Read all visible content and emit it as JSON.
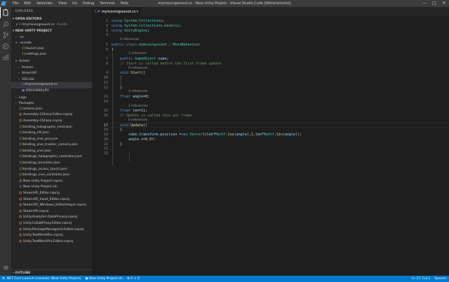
{
  "titlebar": {
    "menu": [
      "File",
      "Edit",
      "Selection",
      "View",
      "Go",
      "Debug",
      "Terminal",
      "Help"
    ],
    "window_title": "mymovingsound.cs - New Unity Project - Visual Studio Code [Administrator]",
    "minimize": "—",
    "maximize": "□",
    "close": "✕"
  },
  "activitybar": {
    "icons": [
      "explorer-icon",
      "search-icon",
      "source-control-icon",
      "debug-icon",
      "extensions-icon"
    ],
    "settings": "gear-icon"
  },
  "sidebar": {
    "header": "EXPLORER",
    "open_editors": "OPEN EDITORS",
    "open_file": {
      "name": "mymovingsound.cs",
      "path": "Assets"
    },
    "project": "NEW UNITY PROJECT",
    "tree": [
      {
        "label": ".vs",
        "indent": 1,
        "kind": "folder-closed"
      },
      {
        "label": ".vscode",
        "indent": 1,
        "kind": "folder-open"
      },
      {
        "label": "launch.json",
        "indent": 2,
        "kind": "json"
      },
      {
        "label": "settings.json",
        "indent": 2,
        "kind": "json"
      },
      {
        "label": "Assets",
        "indent": 1,
        "kind": "folder-open"
      },
      {
        "label": "Scenes",
        "indent": 2,
        "kind": "folder-closed"
      },
      {
        "label": "SteamVR",
        "indent": 2,
        "kind": "folder-closed"
      },
      {
        "label": "VSCode",
        "indent": 2,
        "kind": "folder-closed"
      },
      {
        "label": "mymovingsound.cs",
        "indent": 2,
        "kind": "cs",
        "selected": true
      },
      {
        "label": "R0010699.JPG",
        "indent": 2,
        "kind": "img"
      },
      {
        "label": "Logs",
        "indent": 1,
        "kind": "folder-closed"
      },
      {
        "label": "Packages",
        "indent": 1,
        "kind": "folder-closed"
      },
      {
        "label": "actions.json",
        "indent": 1,
        "kind": "json"
      },
      {
        "label": "Assembly-CSharp-Editor.csproj",
        "indent": 1,
        "kind": "proj"
      },
      {
        "label": "Assembly-CSharp.csproj",
        "indent": 1,
        "kind": "proj"
      },
      {
        "label": "binding_holographic_hmd.json",
        "indent": 1,
        "kind": "json"
      },
      {
        "label": "binding_rift.json",
        "indent": 1,
        "kind": "json"
      },
      {
        "label": "binding_vive_pro.json",
        "indent": 1,
        "kind": "json"
      },
      {
        "label": "binding_vive_tracker_camera.json",
        "indent": 1,
        "kind": "json"
      },
      {
        "label": "binding_vive.json",
        "indent": 1,
        "kind": "json"
      },
      {
        "label": "bindings_holographic_controller.json",
        "indent": 1,
        "kind": "json"
      },
      {
        "label": "bindings_knuckles.json",
        "indent": 1,
        "kind": "json"
      },
      {
        "label": "bindings_oculus_touch.json",
        "indent": 1,
        "kind": "json"
      },
      {
        "label": "bindings_vive_controller.json",
        "indent": 1,
        "kind": "json"
      },
      {
        "label": "New Unity Project.csproj",
        "indent": 1,
        "kind": "proj"
      },
      {
        "label": "New Unity Project.sln",
        "indent": 1,
        "kind": "sln"
      },
      {
        "label": "SteamVR_Editor.csproj",
        "indent": 1,
        "kind": "proj"
      },
      {
        "label": "SteamVR_Input_Editor.csproj",
        "indent": 1,
        "kind": "proj"
      },
      {
        "label": "SteamVR_Windows_EditorHelper.csproj",
        "indent": 1,
        "kind": "proj"
      },
      {
        "label": "SteamVR.csproj",
        "indent": 1,
        "kind": "proj"
      },
      {
        "label": "Unity.Analytics.DataPrivacy.csproj",
        "indent": 1,
        "kind": "proj"
      },
      {
        "label": "Unity.CollabProxy.Editor.csproj",
        "indent": 1,
        "kind": "proj"
      },
      {
        "label": "Unity.PackageManagerUI.Editor.csproj",
        "indent": 1,
        "kind": "proj"
      },
      {
        "label": "Unity.TextMeshPro.csproj",
        "indent": 1,
        "kind": "proj"
      },
      {
        "label": "Unity.TextMeshPro.Editor.csproj",
        "indent": 1,
        "kind": "proj"
      }
    ],
    "outline": "OUTLINE"
  },
  "tab": {
    "label": "mymovingsound.cs",
    "close": "×"
  },
  "editor": {
    "current_line": 17,
    "lines": [
      {
        "type": "code",
        "n": 1,
        "html": "<span class='kw'>using</span> <span class='ty'>System</span>.<span class='ty'>Collections</span>;"
      },
      {
        "type": "code",
        "n": 2,
        "html": "<span class='kw'>using</span> <span class='ty'>System</span>.<span class='ty'>Collections</span>.<span class='ty'>Generic</span>;"
      },
      {
        "type": "code",
        "n": 3,
        "html": "<span class='kw'>using</span> <span class='ty'>UnityEngine</span>;"
      },
      {
        "type": "code",
        "n": 4,
        "html": ""
      },
      {
        "type": "lens",
        "text": "0 references",
        "indent": 0
      },
      {
        "type": "code",
        "n": 5,
        "html": "<span class='kw'>public</span> <span class='kw'>class</span> <span class='ty'>mymovingsound</span> : <span class='ty'>MonoBehaviour</span>"
      },
      {
        "type": "code",
        "n": 6,
        "html": "{"
      },
      {
        "type": "lens",
        "text": "1 reference",
        "indent": 1
      },
      {
        "type": "code",
        "n": 7,
        "html": "    <span class='kw'>public</span> <span class='ty'>GameObject</span> <span class='va'>cube</span>;"
      },
      {
        "type": "code",
        "n": 8,
        "html": "    <span class='cm'>// Start is called before the first frame update</span>"
      },
      {
        "type": "lens",
        "text": "0 references",
        "indent": 1
      },
      {
        "type": "code",
        "n": 9,
        "html": "    <span class='kw'>void</span> <span class='fn'>Start</span>()"
      },
      {
        "type": "code",
        "n": 10,
        "html": "    {"
      },
      {
        "type": "code",
        "n": 11,
        "html": ""
      },
      {
        "type": "code",
        "n": 12,
        "html": "    }"
      },
      {
        "type": "lens",
        "text": "3 references",
        "indent": 1
      },
      {
        "type": "code",
        "n": 13,
        "html": "    <span class='kw'>float</span> <span class='va'>angle</span>=<span class='nm'>0</span>;"
      },
      {
        "type": "code",
        "n": 14,
        "html": ""
      },
      {
        "type": "lens",
        "text": "2 references",
        "indent": 1
      },
      {
        "type": "code",
        "n": 15,
        "html": "    <span class='kw'>float</span> <span class='va'>len</span>=<span class='nm'>11</span>;"
      },
      {
        "type": "code",
        "n": 16,
        "html": "    <span class='cm'>// Update is called once per frame</span>"
      },
      {
        "type": "lens",
        "text": "0 references",
        "indent": 1
      },
      {
        "type": "code",
        "n": 17,
        "html": "    <span class='kw'>void</span> <span class='fn'>Update</span>()"
      },
      {
        "type": "code",
        "n": 18,
        "html": "    {"
      },
      {
        "type": "code",
        "n": 19,
        "html": "        <span class='va'>cube</span>.<span class='va'>transform</span>.<span class='va'>position</span> =<span class='kw'>new</span> <span class='ty'>Vector3</span>(<span class='va'>len</span>*<span class='ty'>Mathf</span>.<span class='fn'>Cos</span>(<span class='va'>angle</span>),<span class='nm'>1</span>,<span class='va'>len</span>*<span class='ty'>Mathf</span>.<span class='fn'>Sin</span>(<span class='va'>angle</span>));"
      },
      {
        "type": "code",
        "n": 20,
        "html": "        <span class='va'>angle</span> +=<span class='nm'>0.0f</span>;"
      },
      {
        "type": "code",
        "n": 21,
        "html": "    }"
      },
      {
        "type": "code",
        "n": 22,
        "html": "}"
      },
      {
        "type": "code",
        "n": 23,
        "html": ""
      }
    ]
  },
  "statusbar": {
    "launch": "⚙ .NET Core Launch (console) (New Unity Project)",
    "solution": "▣ New Unity Project.sln",
    "errors": "⊗ 0  ⚠ 0",
    "position": "Ln 17, Col 1",
    "spaces": "Spaces:"
  },
  "colors": {
    "accent": "#007acc",
    "sidebar_bg": "#252526",
    "editor_bg": "#1e1e1e",
    "activity_bg": "#333333"
  }
}
